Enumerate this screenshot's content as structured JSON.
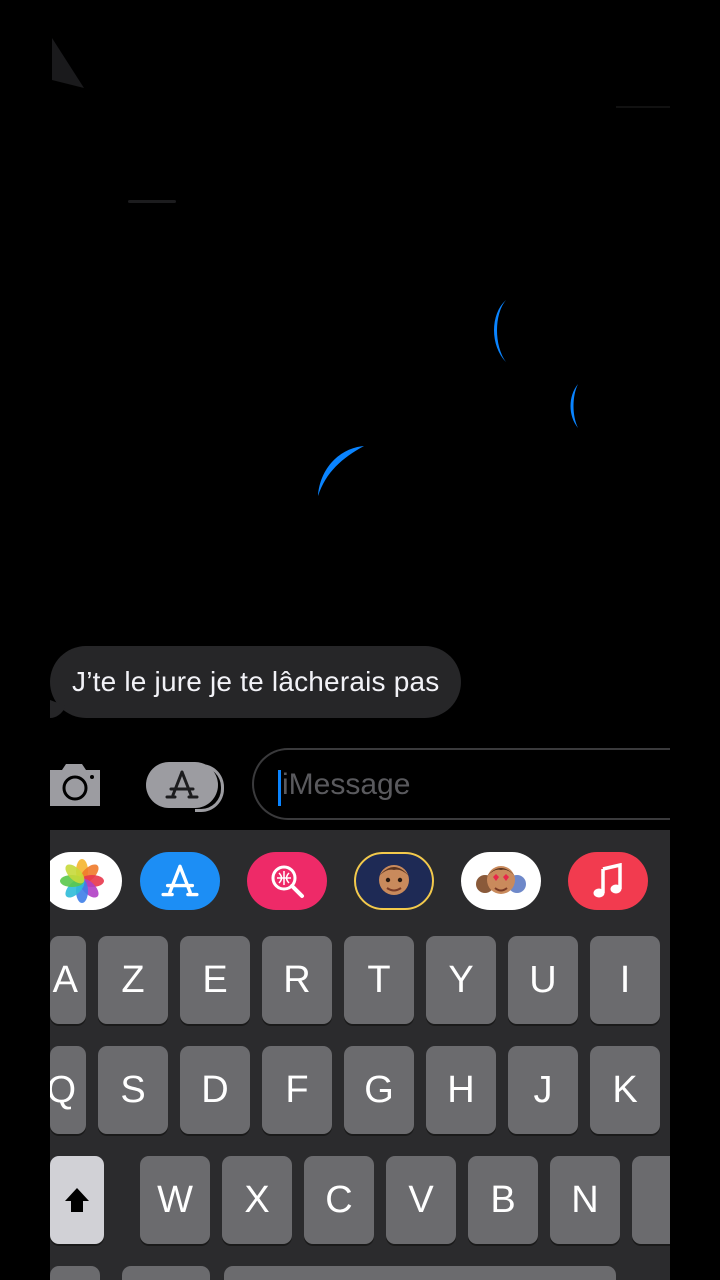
{
  "conversation": {
    "received_message": "J’te le jure je te lâcherais pas"
  },
  "compose": {
    "placeholder": "iMessage"
  },
  "app_strip": [
    {
      "name": "photos-app-icon"
    },
    {
      "name": "app-store-icon"
    },
    {
      "name": "images-search-icon"
    },
    {
      "name": "memoji-icon"
    },
    {
      "name": "memoji-stickers-icon"
    },
    {
      "name": "music-icon"
    }
  ],
  "keyboard": {
    "row1": [
      "A",
      "Z",
      "E",
      "R",
      "T",
      "Y",
      "U",
      "I"
    ],
    "row2": [
      "Q",
      "S",
      "D",
      "F",
      "G",
      "H",
      "J",
      "K"
    ],
    "row3": [
      "W",
      "X",
      "C",
      "V",
      "B",
      "N"
    ]
  },
  "colors": {
    "background": "#000000",
    "bubble_received": "#262628",
    "accent_blue": "#0a84ff",
    "keyboard_bg": "#2b2b2d",
    "key_bg": "#6b6b6e"
  }
}
